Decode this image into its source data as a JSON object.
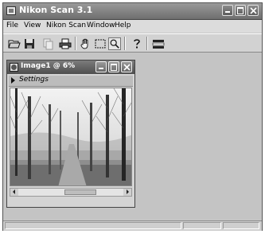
{
  "app": {
    "title": "Nikon Scan 3.1"
  },
  "menu": {
    "items": [
      "File",
      "View",
      "Nikon Scan",
      "Window",
      "Help"
    ]
  },
  "toolbar": {
    "buttons": [
      {
        "icon": "open-folder-icon"
      },
      {
        "icon": "save-icon"
      },
      {
        "icon": "copy-icon"
      },
      {
        "icon": "print-icon"
      },
      {
        "icon": "hand-icon"
      },
      {
        "icon": "marquee-select-icon"
      },
      {
        "icon": "zoom-icon"
      },
      {
        "icon": "help-icon"
      },
      {
        "icon": "settings-icon"
      }
    ]
  },
  "image_window": {
    "title": "Image1 @ 6%",
    "settings_label": "Settings"
  },
  "colors": {
    "title_bar": "#7a7a7a",
    "background": "#c4c4c4"
  }
}
